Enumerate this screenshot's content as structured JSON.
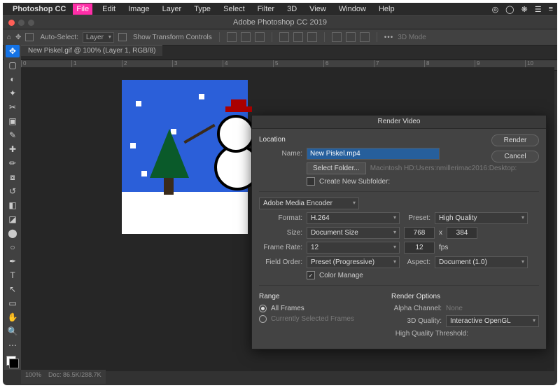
{
  "menubar": {
    "app": "Photoshop CC",
    "items": [
      "File",
      "Edit",
      "Image",
      "Layer",
      "Type",
      "Select",
      "Filter",
      "3D",
      "View",
      "Window",
      "Help"
    ],
    "highlighted": "File",
    "tray": [
      "◎",
      "◯",
      "❋",
      "☰",
      "≡"
    ]
  },
  "window": {
    "title": "Adobe Photoshop CC 2019"
  },
  "optionsbar": {
    "auto_select_label": "Auto-Select:",
    "auto_select_value": "Layer",
    "transform_label": "Show Transform Controls",
    "mode_3d": "3D Mode"
  },
  "document": {
    "tab": "New Piskel.gif @ 100% (Layer 1, RGB/8)"
  },
  "ruler": {
    "marks": [
      "0",
      "1",
      "2",
      "3",
      "4",
      "5",
      "6",
      "7",
      "8",
      "9",
      "10"
    ]
  },
  "tools": [
    "move",
    "marquee",
    "lasso",
    "wand",
    "crop",
    "frame",
    "eyedrop",
    "heal",
    "brush",
    "stamp",
    "history",
    "eraser",
    "gradient",
    "blur",
    "dodge",
    "pen",
    "type",
    "path",
    "rect",
    "hand",
    "zoom",
    "more"
  ],
  "dialog": {
    "title": "Render Video",
    "render_btn": "Render",
    "cancel_btn": "Cancel",
    "location_label": "Location",
    "name_label": "Name:",
    "name_value": "New Piskel.mp4",
    "select_folder_btn": "Select Folder...",
    "folder_path": "Macintosh HD:Users:nmillerimac2016:Desktop:",
    "subfolder_label": "Create New Subfolder:",
    "encoder": "Adobe Media Encoder",
    "format_label": "Format:",
    "format_value": "H.264",
    "preset_label": "Preset:",
    "preset_value": "High Quality",
    "size_label": "Size:",
    "size_value": "Document Size",
    "width": "768",
    "height": "384",
    "x": "x",
    "framerate_label": "Frame Rate:",
    "framerate_value": "12",
    "framerate_value2": "12",
    "fps": "fps",
    "fieldorder_label": "Field Order:",
    "fieldorder_value": "Preset (Progressive)",
    "aspect_label": "Aspect:",
    "aspect_value": "Document (1.0)",
    "color_manage": "Color Manage",
    "range_label": "Range",
    "all_frames": "All Frames",
    "cur_frames": "Currently Selected Frames",
    "render_opts": "Render Options",
    "alpha_label": "Alpha Channel:",
    "alpha_value": "None",
    "quality3d_label": "3D Quality:",
    "quality3d_value": "Interactive OpenGL",
    "hq_thresh": "High Quality Threshold:"
  },
  "statusbar": {
    "zoom": "100%",
    "doc": "Doc: 86.5K/288.7K"
  }
}
